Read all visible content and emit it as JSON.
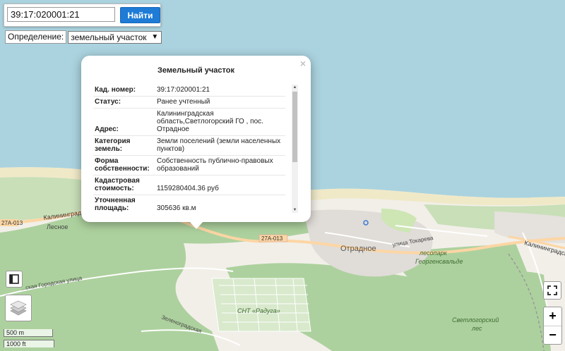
{
  "search": {
    "value": "39:17:020001:21",
    "button_label": "Найти"
  },
  "definition": {
    "label": "Определение:",
    "selected": "земельный участок"
  },
  "popup": {
    "title": "Земельный участок",
    "rows": [
      {
        "key": "Кад. номер:",
        "value": "39:17:020001:21"
      },
      {
        "key": "Статус:",
        "value": "Ранее учтенный"
      },
      {
        "key": "Адрес:",
        "value": "Калининградская область,Светлогорский ГО , пос. Отрадное"
      },
      {
        "key": "Категория земель:",
        "value": "Земли поселений (земли населенных пунктов)"
      },
      {
        "key": "Форма собственности:",
        "value": "Собственность публично-правовых образований"
      },
      {
        "key": "Кадастровая стоимость:",
        "value": "1159280404.36 руб"
      },
      {
        "key": "Уточненная площадь:",
        "value": "305636 кв.м"
      }
    ]
  },
  "map_labels": {
    "road_27a013_left": "27А-013",
    "road_27a013_center": "27А-013",
    "road_kaliningradskaya_left": "Калининградская",
    "road_kaliningradskaya_right": "Калининградская",
    "place_lesnoe": "Лесное",
    "place_otradnoe": "Отрадное",
    "street_tokareva": "улица Токарева",
    "place_lesopark": "лесопарк",
    "place_georgenswalde": "Георгенсвальде",
    "snt_raduga": "СНТ «Радуга»",
    "svetlogorsky_les_1": "Светлогорский",
    "svetlogorsky_les_2": "лес",
    "street_left_bottom": "Зеленоградская",
    "street_left_mid": "...ская Городская улица"
  },
  "scale": {
    "metric": "500 m",
    "imperial": "1000 ft"
  },
  "colors": {
    "water": "#aad3df",
    "land": "#f2efe9",
    "forest": "#add19e",
    "sand": "#f0e9c8",
    "road_primary": "#fcd6a4",
    "button_blue": "#1e7bd6"
  }
}
